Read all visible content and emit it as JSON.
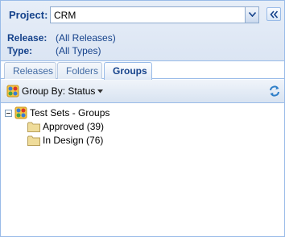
{
  "project": {
    "label": "Project:",
    "value": "CRM"
  },
  "filters": {
    "release_label": "Release:",
    "release_value": "(All Releases)",
    "type_label": "Type:",
    "type_value": "(All Types)"
  },
  "tabs": [
    {
      "label": "Releases",
      "active": false
    },
    {
      "label": "Folders",
      "active": false
    },
    {
      "label": "Groups",
      "active": true
    }
  ],
  "toolbar": {
    "group_by_label": "Group By: Status"
  },
  "tree": {
    "root": {
      "label": "Test Sets - Groups",
      "expanded": true
    },
    "children": [
      {
        "label": "Approved (39)",
        "icon": "folder-icon"
      },
      {
        "label": "In Design (76)",
        "icon": "folder-icon"
      }
    ]
  },
  "colors": {
    "header_text": "#15428b",
    "panel_border": "#99bbe8",
    "folder": "#e8d48a"
  }
}
